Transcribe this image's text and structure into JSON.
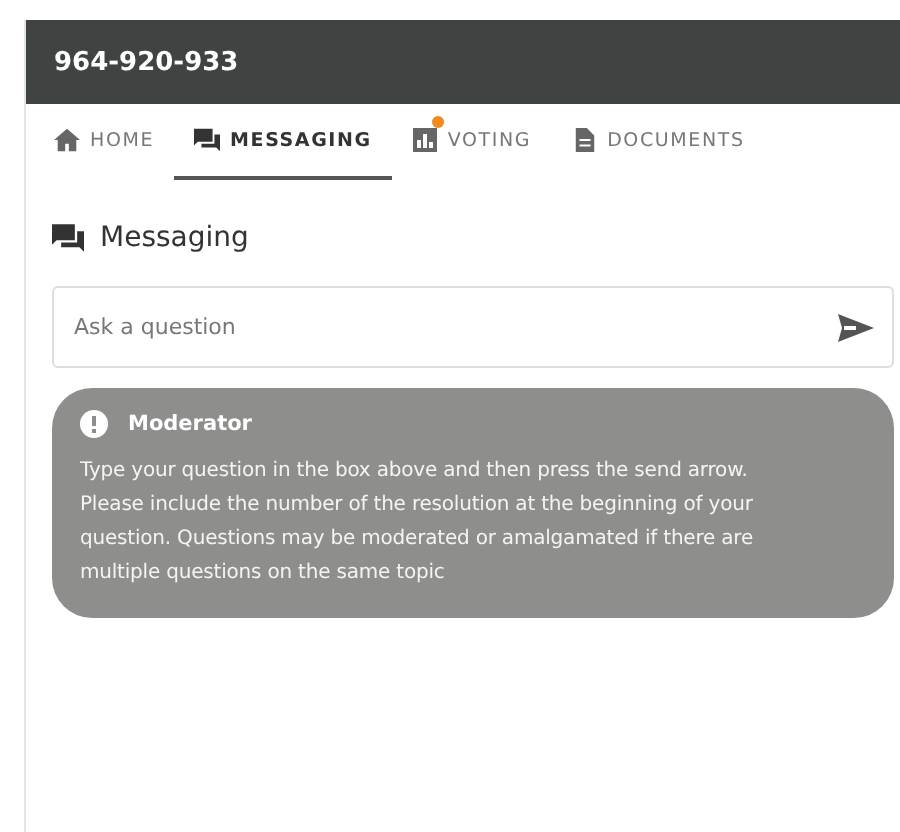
{
  "header": {
    "title": "964-920-933"
  },
  "tabs": [
    {
      "label": "HOME",
      "kind": "home",
      "selected": false,
      "notification": false
    },
    {
      "label": "MESSAGING",
      "kind": "chat",
      "selected": true,
      "notification": false
    },
    {
      "label": "VOTING",
      "kind": "chart",
      "selected": false,
      "notification": true
    },
    {
      "label": "DOCUMENTS",
      "kind": "document",
      "selected": false,
      "notification": false
    }
  ],
  "section": {
    "title": "Messaging"
  },
  "question_field": {
    "placeholder": "Ask a question"
  },
  "moderator_message": {
    "author": "Moderator",
    "text": "Type your question in the box above and then press the send arrow. Please include the number of the resolution at the beginning of your question. Questions may be moderated or amalgamated if there are multiple questions on the same topic"
  }
}
